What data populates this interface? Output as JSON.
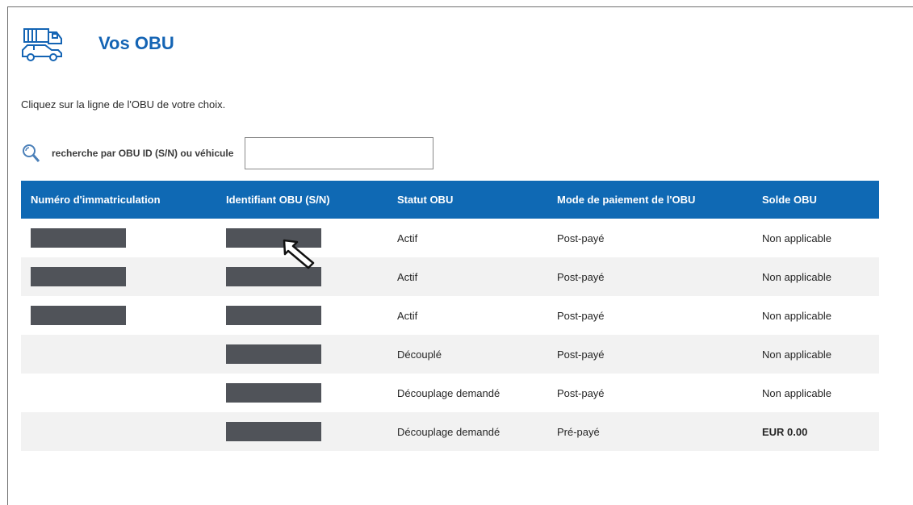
{
  "page": {
    "title": "Vos OBU",
    "instructions": "Cliquez sur la ligne de l'OBU de votre choix.",
    "search": {
      "label": "recherche par OBU ID (S/N) ou véhicule",
      "value": "",
      "placeholder": ""
    }
  },
  "table": {
    "headers": [
      "Numéro d'immatriculation",
      "Identifiant OBU (S/N)",
      "Statut OBU",
      "Mode de paiement de l'OBU",
      "Solde OBU"
    ],
    "rows": [
      {
        "plate_redacted": true,
        "obu_redacted": true,
        "status": "Actif",
        "status_type": "active",
        "payment": "Post-payé",
        "balance": "Non applicable"
      },
      {
        "plate_redacted": true,
        "obu_redacted": true,
        "status": "Actif",
        "status_type": "active",
        "payment": "Post-payé",
        "balance": "Non applicable"
      },
      {
        "plate_redacted": true,
        "obu_redacted": true,
        "status": "Actif",
        "status_type": "active",
        "payment": "Post-payé",
        "balance": "Non applicable"
      },
      {
        "plate_redacted": false,
        "obu_redacted": true,
        "status": "Découplé",
        "status_type": "decoupled",
        "payment": "Post-payé",
        "balance": "Non applicable"
      },
      {
        "plate_redacted": false,
        "obu_redacted": true,
        "status": "Découplage demandé",
        "status_type": "decoupled",
        "payment": "Post-payé",
        "balance": "Non applicable"
      },
      {
        "plate_redacted": false,
        "obu_redacted": true,
        "status": "Découplage demandé",
        "status_type": "decoupled",
        "payment": "Pré-payé",
        "balance": "EUR 0.00"
      }
    ]
  },
  "colors": {
    "brand_blue": "#1464b4",
    "header_bg": "#0f69b4",
    "status_active": "#1c6e1c",
    "status_decoupled": "#e01e1e",
    "redaction": "#505359"
  },
  "icons": {
    "header": "truck-car-icon",
    "search": "search-icon",
    "cursor": "mouse-pointer-icon"
  }
}
